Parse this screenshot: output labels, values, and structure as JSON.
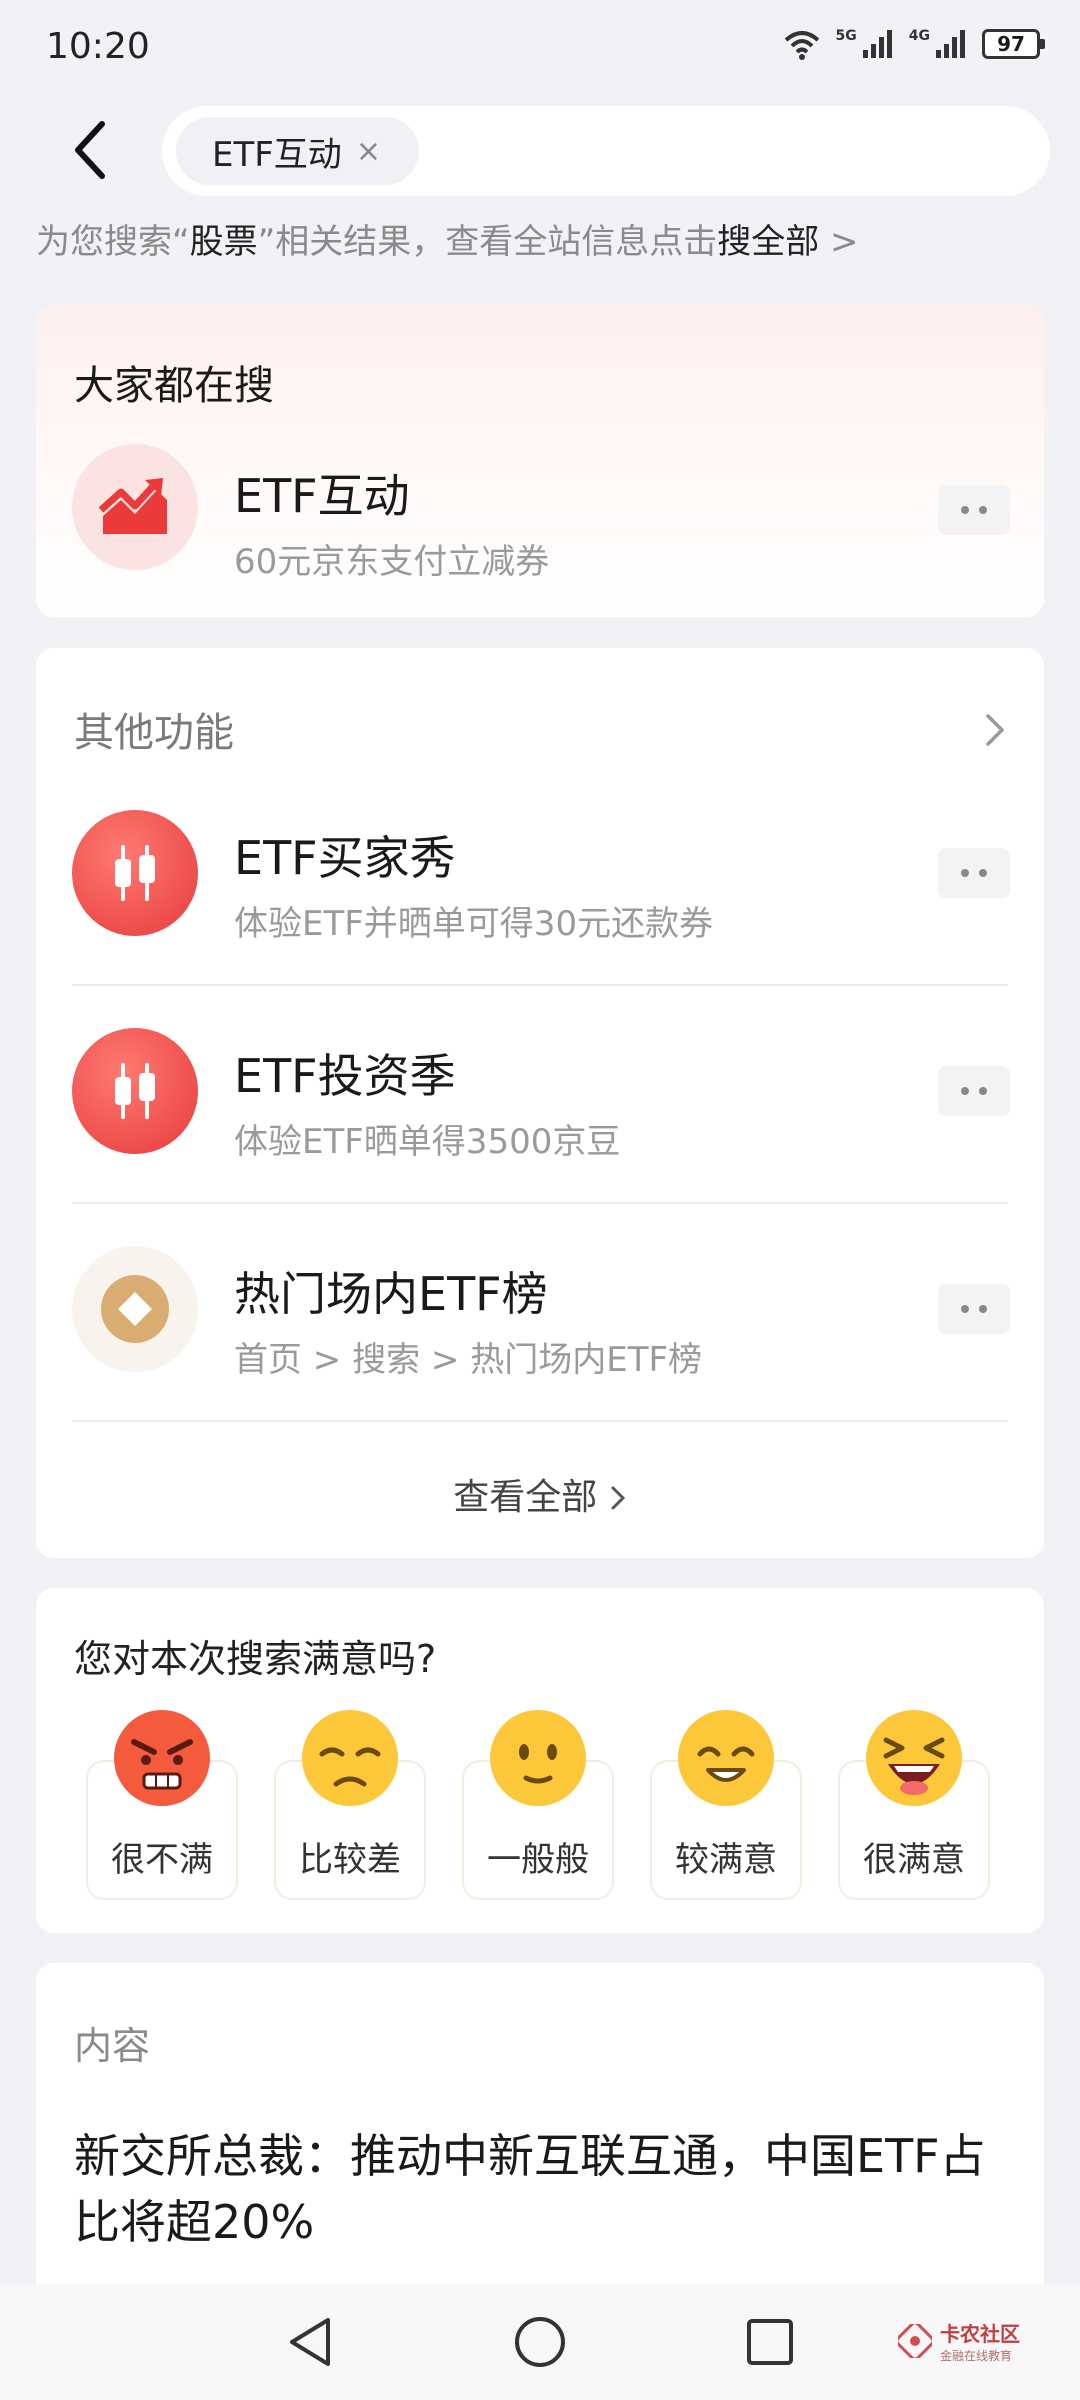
{
  "status": {
    "time": "10:20",
    "network_1": "5G",
    "network_2": "4G",
    "battery": "97"
  },
  "search": {
    "chip_label": "ETF互动",
    "chip_close": "×"
  },
  "hint": {
    "prefix": "为您搜索“",
    "keyword": "股票",
    "middle": "”相关结果，查看全站信息点击",
    "link": "搜全部",
    "arrow": " >"
  },
  "trending": {
    "title": "大家都在搜",
    "item": {
      "title": "ETF互动",
      "subtitle": "60元京东支付立减券",
      "icon": "trend-up-icon"
    }
  },
  "other_functions": {
    "title": "其他功能",
    "items": [
      {
        "title": "ETF买家秀",
        "subtitle": "体验ETF并晒单可得30元还款券",
        "icon": "candlestick-icon",
        "icon_color": "#f25050"
      },
      {
        "title": "ETF投资季",
        "subtitle": "体验ETF晒单得3500京豆",
        "icon": "candlestick-icon",
        "icon_color": "#f25050"
      },
      {
        "title": "热门场内ETF榜",
        "subtitle": "首页 > 搜索 > 热门场内ETF榜",
        "icon": "diamond-coin-icon",
        "icon_color": "#d9ad72"
      }
    ],
    "see_all": "查看全部"
  },
  "feedback": {
    "question": "您对本次搜索满意吗?",
    "options": [
      {
        "label": "很不满",
        "icon": "angry-face-icon"
      },
      {
        "label": "比较差",
        "icon": "sad-face-icon"
      },
      {
        "label": "一般般",
        "icon": "neutral-face-icon"
      },
      {
        "label": "较满意",
        "icon": "smile-face-icon"
      },
      {
        "label": "很满意",
        "icon": "laugh-face-icon"
      }
    ]
  },
  "content": {
    "title": "内容",
    "article_title": "新交所总裁：推动中新互联互通，中国ETF占比将超20%"
  },
  "watermark": {
    "main": "卡农社区",
    "sub": "金融在线教育"
  },
  "colors": {
    "accent_red": "#f25050",
    "gold": "#d9ad72",
    "background": "#f2f2f6"
  }
}
